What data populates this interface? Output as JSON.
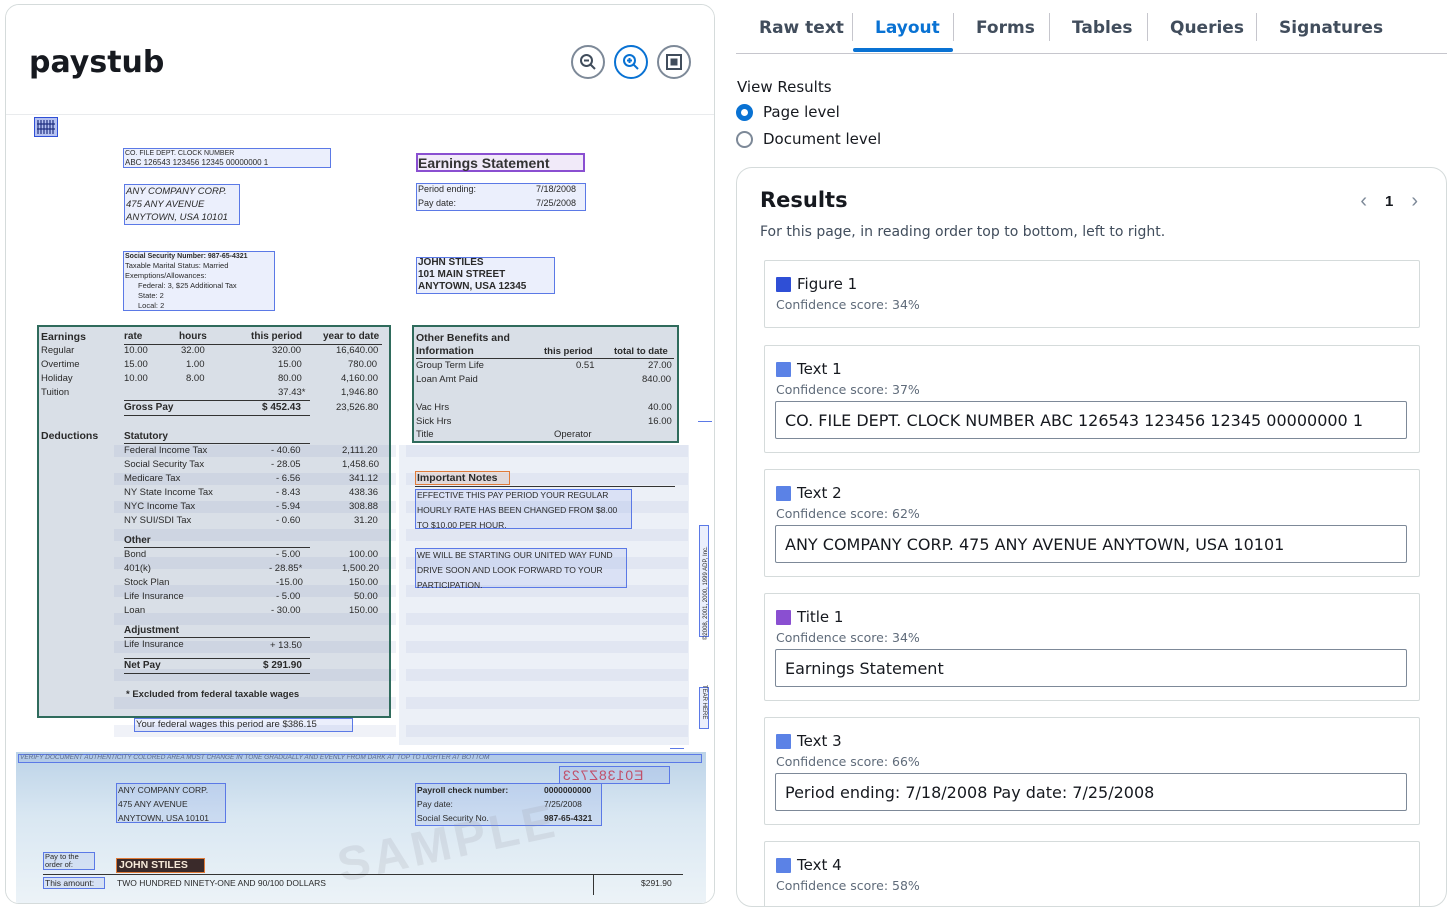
{
  "document": {
    "title": "paystub",
    "zoom_out_icon": "zoom-out-icon",
    "zoom_in_icon": "zoom-in-icon",
    "fit_icon": "fit-page-icon",
    "paystub": {
      "header_row1": "CO.   FILE    DEPT.   CLOCK   NUMBER",
      "header_row2": "ABC  126543 123456 12345 00000000  1",
      "company_line1": "ANY COMPANY CORP.",
      "company_line2": "475 ANY AVENUE",
      "company_line3": "ANYTOWN, USA 10101",
      "ssn_line": "Social Security Number: 987-65-4321",
      "marital_line": "Taxable Marital Status: Married",
      "exemptions_line": "Exemptions/Allowances:",
      "federal_line": "Federal:  3, $25 Additional Tax",
      "state_line": "State:   2",
      "local_line": "Local:   2",
      "earnings_title": "Earnings Statement",
      "period_ending_label": "Period ending:",
      "period_ending_value": "7/18/2008",
      "pay_date_label": "Pay date:",
      "pay_date_value": "7/25/2008",
      "employee_line1": "JOHN STILES",
      "employee_line2": "101 MAIN STREET",
      "employee_line3": "ANYTOWN, USA 12345",
      "earnings_headers": [
        "Earnings",
        "rate",
        "hours",
        "this period",
        "year to date"
      ],
      "earnings_rows": [
        [
          "Regular",
          "10.00",
          "32.00",
          "320.00",
          "16,640.00"
        ],
        [
          "Overtime",
          "15.00",
          "1.00",
          "15.00",
          "780.00"
        ],
        [
          "Holiday",
          "10.00",
          "8.00",
          "80.00",
          "4,160.00"
        ],
        [
          "Tuition",
          "",
          "",
          "37.43*",
          "1,946.80"
        ]
      ],
      "gross_pay_label": "Gross Pay",
      "gross_pay_value": "$ 452.43",
      "gross_pay_ytd": "23,526.80",
      "deductions_label": "Deductions",
      "statutory_label": "Statutory",
      "deduction_rows": [
        [
          "Federal Income Tax",
          "- 40.60",
          "2,111.20"
        ],
        [
          "Social Security Tax",
          "- 28.05",
          "1,458.60"
        ],
        [
          "Medicare Tax",
          "- 6.56",
          "341.12"
        ],
        [
          "NY State Income Tax",
          "- 8.43",
          "438.36"
        ],
        [
          "NYC Income Tax",
          "- 5.94",
          "308.88"
        ],
        [
          "NY SUI/SDI Tax",
          "- 0.60",
          "31.20"
        ]
      ],
      "other_label": "Other",
      "other_rows": [
        [
          "Bond",
          "- 5.00",
          "100.00"
        ],
        [
          "401(k)",
          "- 28.85*",
          "1,500.20"
        ],
        [
          "Stock Plan",
          "-15.00",
          "150.00"
        ],
        [
          "Life Insurance",
          "- 5.00",
          "50.00"
        ],
        [
          "Loan",
          "- 30.00",
          "150.00"
        ]
      ],
      "adjustment_label": "Adjustment",
      "adjustment_row": [
        "Life Insurance",
        "+ 13.50"
      ],
      "net_pay_label": "Net Pay",
      "net_pay_value": "$ 291.90",
      "excluded_note": "* Excluded from federal taxable wages",
      "federal_wages_note": "Your federal wages this period are $386.15",
      "benefits_title1": "Other Benefits and",
      "benefits_title2": "Information",
      "benefits_col1": "this period",
      "benefits_col2": "total to date",
      "benefits_rows": [
        [
          "Group Term Life",
          "0.51",
          "27.00"
        ],
        [
          "Loan Amt Paid",
          "",
          "840.00"
        ],
        [
          "",
          "",
          ""
        ],
        [
          "Vac Hrs",
          "",
          "40.00"
        ],
        [
          "Sick Hrs",
          "",
          "16.00"
        ],
        [
          "Title",
          "Operator",
          ""
        ]
      ],
      "important_notes_title": "Important Notes",
      "note1_line1": "EFFECTIVE THIS PAY PERIOD YOUR REGULAR",
      "note1_line2": "HOURLY RATE HAS BEEN CHANGED FROM $8.00",
      "note1_line3": "TO $10.00 PER HOUR.",
      "note2_line1": "WE WILL BE STARTING OUR UNITED WAY FUND",
      "note2_line2": "DRIVE SOON AND LOOK FORWARD TO YOUR",
      "note2_line3": "PARTICIPATION.",
      "copyright_vertical": "©2008, 2001, 2000, 1999 ADP, Inc.",
      "tear_here": "TEAR HERE",
      "check_banner": "VERIFY DOCUMENT AUTHENTICITY   COLORED AREA MUST CHANGE IN TONE GRADUALLY AND EVENLY FROM DARK AT TOP TO LIGHTER AT BOTTOM",
      "check_number_stamp": "E0138Z723",
      "check_company_line1": "ANY COMPANY CORP.",
      "check_company_line2": "475  ANY  AVENUE",
      "check_company_line3": "ANYTOWN,  USA  10101",
      "payroll_check_label": "Payroll check number:",
      "payroll_check_value": "0000000000",
      "check_pay_date_label": "Pay date:",
      "check_pay_date_value": "7/25/2008",
      "check_ssn_label": "Social Security No.",
      "check_ssn_value": "987-65-4321",
      "pay_to_label1": "Pay to the",
      "pay_to_label2": "order of:",
      "payee_name": "JOHN STILES",
      "this_amount_label": "This amount:",
      "amount_words": "TWO HUNDRED NINETY-ONE AND 90/100 DOLLARS",
      "amount_value": "$291.90",
      "sample_watermark": "SAMPLE"
    }
  },
  "tabs": [
    "Raw text",
    "Layout",
    "Forms",
    "Tables",
    "Queries",
    "Signatures"
  ],
  "active_tab": "Layout",
  "view_results": {
    "label": "View Results",
    "options": [
      "Page level",
      "Document level"
    ],
    "selected": "Page level"
  },
  "results": {
    "title": "Results",
    "description": "For this page, in reading order top to bottom, left to right.",
    "page": "1",
    "items": [
      {
        "label": "Figure 1",
        "score": "Confidence score: 34%",
        "text": "",
        "color": "#2f4fd6"
      },
      {
        "label": "Text 1",
        "score": "Confidence score: 37%",
        "text": "CO. FILE DEPT. CLOCK NUMBER ABC 126543 123456 12345 00000000 1",
        "color": "#5b82e6"
      },
      {
        "label": "Text 2",
        "score": "Confidence score: 62%",
        "text": "ANY COMPANY CORP. 475 ANY AVENUE ANYTOWN, USA 10101",
        "color": "#5b82e6"
      },
      {
        "label": "Title 1",
        "score": "Confidence score: 34%",
        "text": "Earnings Statement",
        "color": "#8a4fd1"
      },
      {
        "label": "Text 3",
        "score": "Confidence score: 66%",
        "text": "Period ending: 7/18/2008 Pay date: 7/25/2008",
        "color": "#5b82e6"
      },
      {
        "label": "Text 4",
        "score": "Confidence score: 58%",
        "text": "",
        "color": "#5b82e6"
      }
    ]
  }
}
